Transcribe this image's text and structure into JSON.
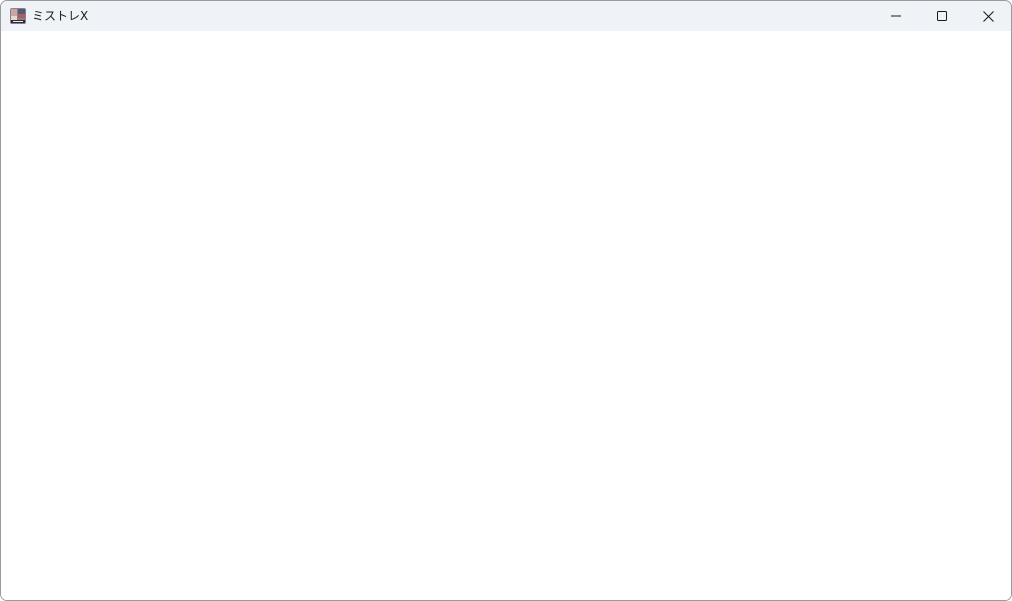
{
  "window": {
    "title": "ミストレX",
    "icon": "app-thumbnail-icon",
    "controls": {
      "minimize_icon": "minimize-icon",
      "maximize_icon": "maximize-icon",
      "close_icon": "close-icon"
    }
  },
  "colors": {
    "titlebar_bg": "#eff3f8",
    "client_bg": "#ffffff",
    "title_text": "#1a1a1a"
  }
}
